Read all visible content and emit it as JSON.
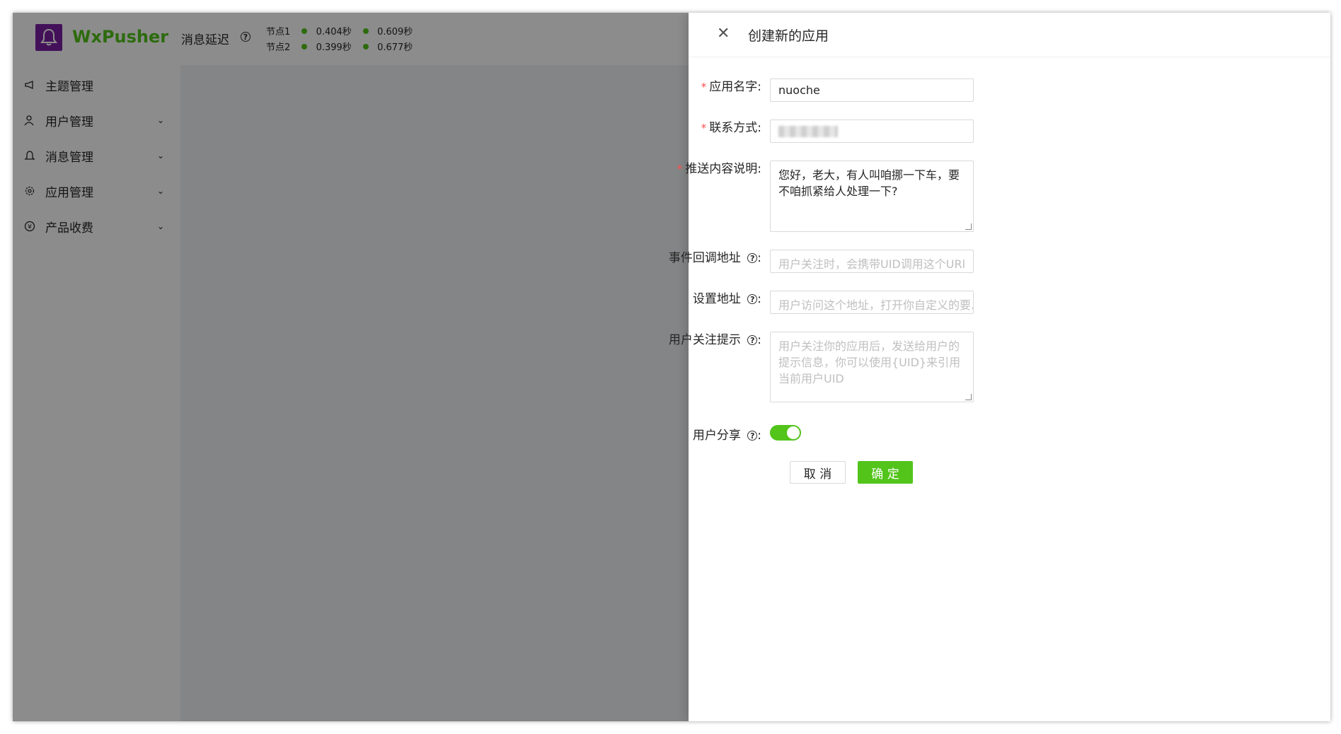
{
  "app": {
    "name": "WxPusher",
    "delay_label": "消息延迟",
    "nodes": [
      {
        "label": "节点1",
        "v1": "0.404秒",
        "v2": "0.609秒"
      },
      {
        "label": "节点2",
        "v1": "0.399秒",
        "v2": "0.677秒"
      }
    ]
  },
  "sidebar": {
    "items": [
      {
        "label": "主题管理",
        "icon": "megaphone-icon",
        "expandable": false
      },
      {
        "label": "用户管理",
        "icon": "users-icon",
        "expandable": true
      },
      {
        "label": "消息管理",
        "icon": "bell-icon",
        "expandable": true
      },
      {
        "label": "应用管理",
        "icon": "gear-icon",
        "expandable": true
      },
      {
        "label": "产品收费",
        "icon": "yen-icon",
        "expandable": true
      }
    ]
  },
  "drawer": {
    "title": "创建新的应用",
    "fields": {
      "app_name": {
        "label": "应用名字",
        "value": "nuoche",
        "required": true
      },
      "contact": {
        "label": "联系方式",
        "value": "",
        "required": true,
        "obscured": true
      },
      "description": {
        "label": "推送内容说明",
        "value": "您好，老大，有人叫咱挪一下车，要不咱抓紧给人处理一下?",
        "required": true
      },
      "callback_url": {
        "label": "事件回调地址",
        "placeholder": "用户关注时，会携带UID调用这个URl"
      },
      "settings_url": {
        "label": "设置地址",
        "placeholder": "用户访问这个地址，打开你自定义的要..."
      },
      "follow_tip": {
        "label": "用户关注提示",
        "placeholder": "用户关注你的应用后，发送给用户的提示信息，你可以使用{UID}来引用当前用户UID"
      },
      "user_share": {
        "label": "用户分享",
        "enabled": true
      }
    },
    "cancel_label": "取 消",
    "ok_label": "确 定"
  },
  "colors": {
    "primary": "#52c41a",
    "brand": "#7b1fa2",
    "required": "#ff4d4f"
  }
}
